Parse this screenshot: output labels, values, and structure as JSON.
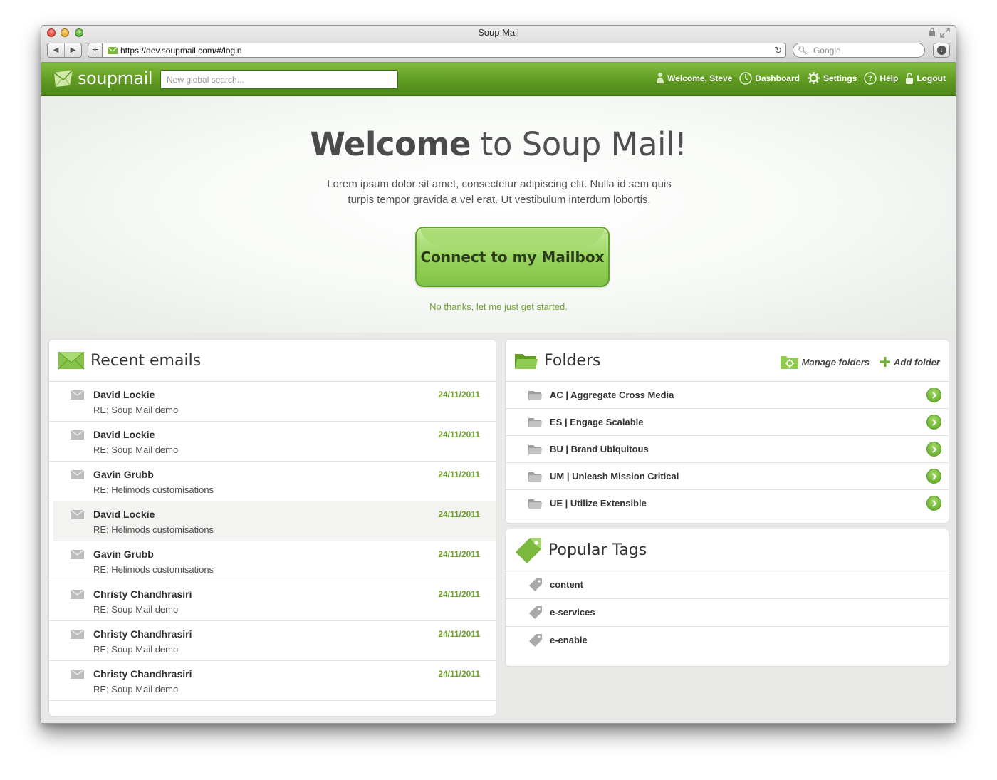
{
  "browser": {
    "window_title": "Soup Mail",
    "url": "https://dev.soupmail.com/#/login",
    "search_placeholder": "Google",
    "add_tab_label": "+",
    "back_label": "◀",
    "forward_label": "▶"
  },
  "header": {
    "logo_text": "soupmail",
    "search_placeholder": "New global search...",
    "nav": {
      "welcome": "Welcome, Steve",
      "dashboard": "Dashboard",
      "settings": "Settings",
      "help": "Help",
      "logout": "Logout"
    }
  },
  "hero": {
    "title_bold": "Welcome",
    "title_rest": " to Soup Mail!",
    "text": "Lorem ipsum dolor sit amet, consectetur adipiscing elit. Nulla id sem quis turpis tempor gravida a vel erat. Ut vestibulum interdum lobortis.",
    "connect_button": "Connect to my Mailbox",
    "skip_link": "No thanks, let me just get started."
  },
  "recent_emails": {
    "title": "Recent emails",
    "items": [
      {
        "from": "David Lockie",
        "subject": "RE: Soup Mail demo",
        "date": "24/11/2011"
      },
      {
        "from": "David Lockie",
        "subject": "RE: Soup Mail demo",
        "date": "24/11/2011"
      },
      {
        "from": "Gavin Grubb",
        "subject": "RE: Helimods customisations",
        "date": "24/11/2011"
      },
      {
        "from": "David Lockie",
        "subject": "RE: Helimods customisations",
        "date": "24/11/2011"
      },
      {
        "from": "Gavin Grubb",
        "subject": "RE: Helimods customisations",
        "date": "24/11/2011"
      },
      {
        "from": "Christy Chandhrasiri",
        "subject": "RE: Soup Mail demo",
        "date": "24/11/2011"
      },
      {
        "from": "Christy Chandhrasiri",
        "subject": "RE: Soup Mail demo",
        "date": "24/11/2011"
      },
      {
        "from": "Christy Chandhrasiri",
        "subject": "RE: Soup Mail demo",
        "date": "24/11/2011"
      }
    ]
  },
  "folders": {
    "title": "Folders",
    "manage_label": "Manage folders",
    "add_label": "Add folder",
    "items": [
      {
        "label": "AC | Aggregate Cross Media"
      },
      {
        "label": "ES | Engage Scalable"
      },
      {
        "label": "BU | Brand Ubiquitous"
      },
      {
        "label": "UM | Unleash Mission Critical"
      },
      {
        "label": "UE | Utilize Extensible"
      }
    ]
  },
  "tags": {
    "title": "Popular Tags",
    "items": [
      {
        "label": "content"
      },
      {
        "label": "e-services"
      },
      {
        "label": "e-enable"
      }
    ]
  },
  "icons": {
    "logo": "envelope-logo-icon",
    "mail": "envelope-icon",
    "folder": "folder-icon",
    "tag": "tag-icon",
    "arrow": "arrow-right-circle-icon"
  },
  "colors": {
    "brand_green": "#5f9a21",
    "accent_green": "#6fa22c",
    "button_green": "#96d25c"
  }
}
